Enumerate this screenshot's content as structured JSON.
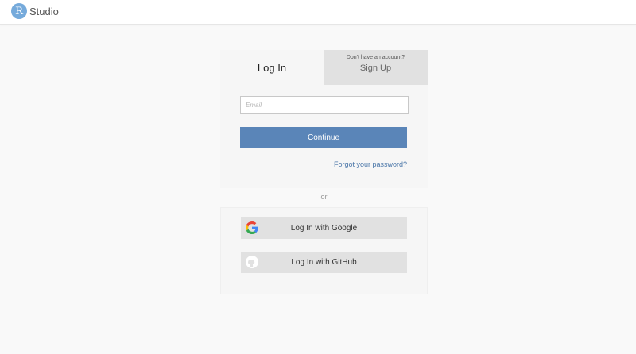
{
  "app": {
    "logo_letter": "R",
    "logo_text": "Studio"
  },
  "tabs": {
    "login_label": "Log In",
    "signup_hint": "Don't have an account?",
    "signup_label": "Sign Up"
  },
  "login_form": {
    "email_placeholder": "Email",
    "email_value": "",
    "continue_label": "Continue",
    "forgot_label": "Forgot your password?"
  },
  "divider": {
    "or_label": "or"
  },
  "oauth": {
    "google_label": "Log In with Google",
    "google_icon": "google-icon",
    "github_label": "Log In with GitHub",
    "github_icon": "github-icon"
  },
  "colors": {
    "brand_blue": "#75aadb",
    "primary_button": "#5a85b8",
    "link": "#4a76a8",
    "background": "#f9f9f9"
  }
}
